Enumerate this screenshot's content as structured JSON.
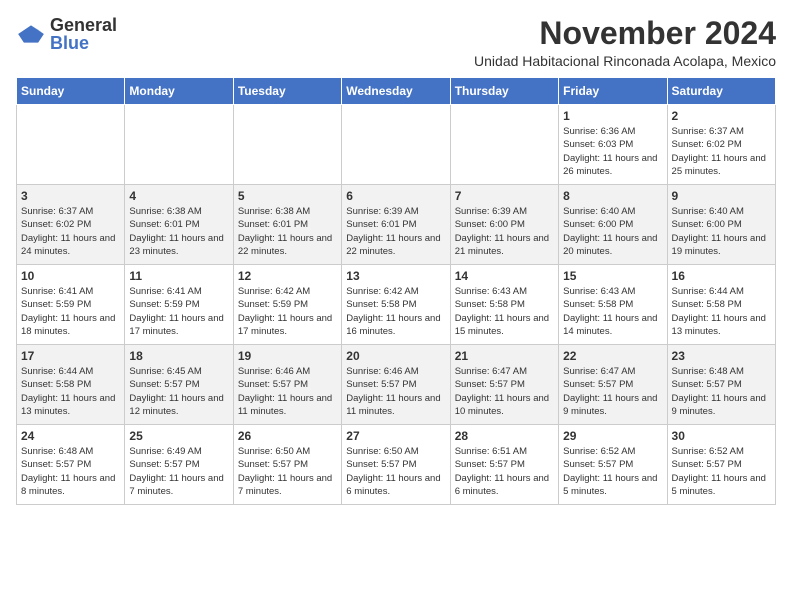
{
  "logo": {
    "general": "General",
    "blue": "Blue"
  },
  "title": "November 2024",
  "subtitle": "Unidad Habitacional Rinconada Acolapa, Mexico",
  "days_of_week": [
    "Sunday",
    "Monday",
    "Tuesday",
    "Wednesday",
    "Thursday",
    "Friday",
    "Saturday"
  ],
  "weeks": [
    [
      {
        "day": "",
        "info": ""
      },
      {
        "day": "",
        "info": ""
      },
      {
        "day": "",
        "info": ""
      },
      {
        "day": "",
        "info": ""
      },
      {
        "day": "",
        "info": ""
      },
      {
        "day": "1",
        "info": "Sunrise: 6:36 AM\nSunset: 6:03 PM\nDaylight: 11 hours and 26 minutes."
      },
      {
        "day": "2",
        "info": "Sunrise: 6:37 AM\nSunset: 6:02 PM\nDaylight: 11 hours and 25 minutes."
      }
    ],
    [
      {
        "day": "3",
        "info": "Sunrise: 6:37 AM\nSunset: 6:02 PM\nDaylight: 11 hours and 24 minutes."
      },
      {
        "day": "4",
        "info": "Sunrise: 6:38 AM\nSunset: 6:01 PM\nDaylight: 11 hours and 23 minutes."
      },
      {
        "day": "5",
        "info": "Sunrise: 6:38 AM\nSunset: 6:01 PM\nDaylight: 11 hours and 22 minutes."
      },
      {
        "day": "6",
        "info": "Sunrise: 6:39 AM\nSunset: 6:01 PM\nDaylight: 11 hours and 22 minutes."
      },
      {
        "day": "7",
        "info": "Sunrise: 6:39 AM\nSunset: 6:00 PM\nDaylight: 11 hours and 21 minutes."
      },
      {
        "day": "8",
        "info": "Sunrise: 6:40 AM\nSunset: 6:00 PM\nDaylight: 11 hours and 20 minutes."
      },
      {
        "day": "9",
        "info": "Sunrise: 6:40 AM\nSunset: 6:00 PM\nDaylight: 11 hours and 19 minutes."
      }
    ],
    [
      {
        "day": "10",
        "info": "Sunrise: 6:41 AM\nSunset: 5:59 PM\nDaylight: 11 hours and 18 minutes."
      },
      {
        "day": "11",
        "info": "Sunrise: 6:41 AM\nSunset: 5:59 PM\nDaylight: 11 hours and 17 minutes."
      },
      {
        "day": "12",
        "info": "Sunrise: 6:42 AM\nSunset: 5:59 PM\nDaylight: 11 hours and 17 minutes."
      },
      {
        "day": "13",
        "info": "Sunrise: 6:42 AM\nSunset: 5:58 PM\nDaylight: 11 hours and 16 minutes."
      },
      {
        "day": "14",
        "info": "Sunrise: 6:43 AM\nSunset: 5:58 PM\nDaylight: 11 hours and 15 minutes."
      },
      {
        "day": "15",
        "info": "Sunrise: 6:43 AM\nSunset: 5:58 PM\nDaylight: 11 hours and 14 minutes."
      },
      {
        "day": "16",
        "info": "Sunrise: 6:44 AM\nSunset: 5:58 PM\nDaylight: 11 hours and 13 minutes."
      }
    ],
    [
      {
        "day": "17",
        "info": "Sunrise: 6:44 AM\nSunset: 5:58 PM\nDaylight: 11 hours and 13 minutes."
      },
      {
        "day": "18",
        "info": "Sunrise: 6:45 AM\nSunset: 5:57 PM\nDaylight: 11 hours and 12 minutes."
      },
      {
        "day": "19",
        "info": "Sunrise: 6:46 AM\nSunset: 5:57 PM\nDaylight: 11 hours and 11 minutes."
      },
      {
        "day": "20",
        "info": "Sunrise: 6:46 AM\nSunset: 5:57 PM\nDaylight: 11 hours and 11 minutes."
      },
      {
        "day": "21",
        "info": "Sunrise: 6:47 AM\nSunset: 5:57 PM\nDaylight: 11 hours and 10 minutes."
      },
      {
        "day": "22",
        "info": "Sunrise: 6:47 AM\nSunset: 5:57 PM\nDaylight: 11 hours and 9 minutes."
      },
      {
        "day": "23",
        "info": "Sunrise: 6:48 AM\nSunset: 5:57 PM\nDaylight: 11 hours and 9 minutes."
      }
    ],
    [
      {
        "day": "24",
        "info": "Sunrise: 6:48 AM\nSunset: 5:57 PM\nDaylight: 11 hours and 8 minutes."
      },
      {
        "day": "25",
        "info": "Sunrise: 6:49 AM\nSunset: 5:57 PM\nDaylight: 11 hours and 7 minutes."
      },
      {
        "day": "26",
        "info": "Sunrise: 6:50 AM\nSunset: 5:57 PM\nDaylight: 11 hours and 7 minutes."
      },
      {
        "day": "27",
        "info": "Sunrise: 6:50 AM\nSunset: 5:57 PM\nDaylight: 11 hours and 6 minutes."
      },
      {
        "day": "28",
        "info": "Sunrise: 6:51 AM\nSunset: 5:57 PM\nDaylight: 11 hours and 6 minutes."
      },
      {
        "day": "29",
        "info": "Sunrise: 6:52 AM\nSunset: 5:57 PM\nDaylight: 11 hours and 5 minutes."
      },
      {
        "day": "30",
        "info": "Sunrise: 6:52 AM\nSunset: 5:57 PM\nDaylight: 11 hours and 5 minutes."
      }
    ]
  ]
}
